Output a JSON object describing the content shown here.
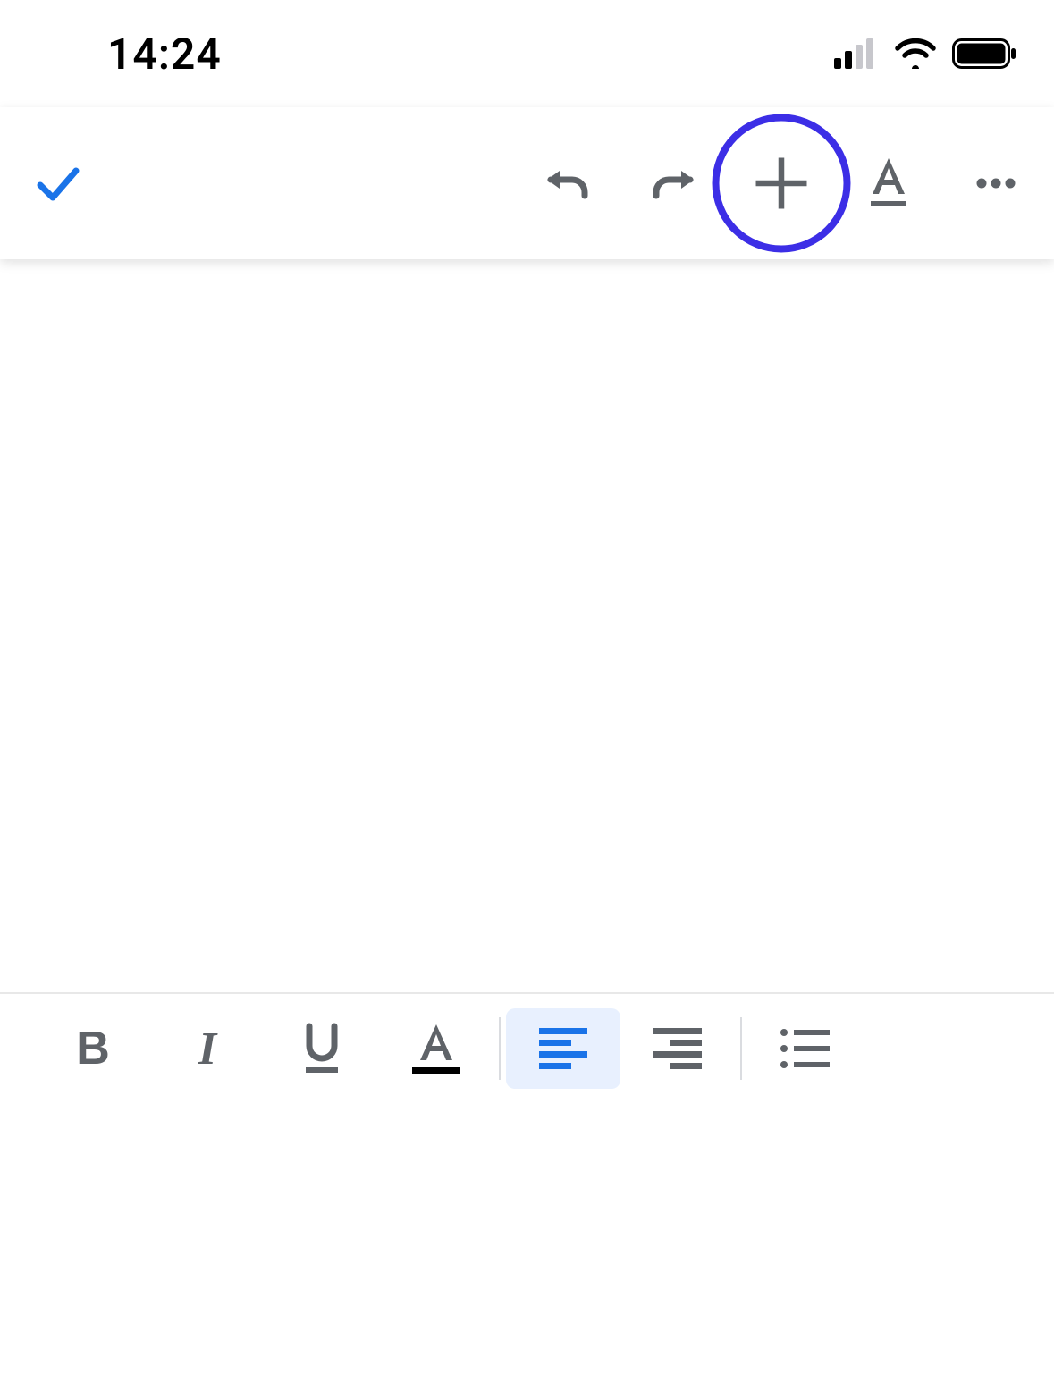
{
  "status": {
    "time": "14:24"
  },
  "toolbar": {
    "done_icon": "checkmark-icon",
    "undo_icon": "undo-icon",
    "redo_icon": "redo-icon",
    "insert_icon": "plus-icon",
    "text_format_icon": "text-format-icon",
    "more_icon": "more-horizontal-icon",
    "highlighted": "insert"
  },
  "bottom_toolbar": {
    "items": [
      {
        "id": "bold",
        "label": "B",
        "selected": false
      },
      {
        "id": "italic",
        "label": "I",
        "selected": false
      },
      {
        "id": "underline",
        "label": "U",
        "selected": false
      },
      {
        "id": "text-color",
        "label": "A",
        "selected": false
      },
      {
        "id": "align-left",
        "selected": true
      },
      {
        "id": "align-right",
        "selected": false
      },
      {
        "id": "bulleted-list",
        "selected": false
      }
    ]
  },
  "colors": {
    "accent_blue": "#1a73e8",
    "highlight_ring": "#3c2ee6",
    "icon_gray": "#5f6368"
  }
}
